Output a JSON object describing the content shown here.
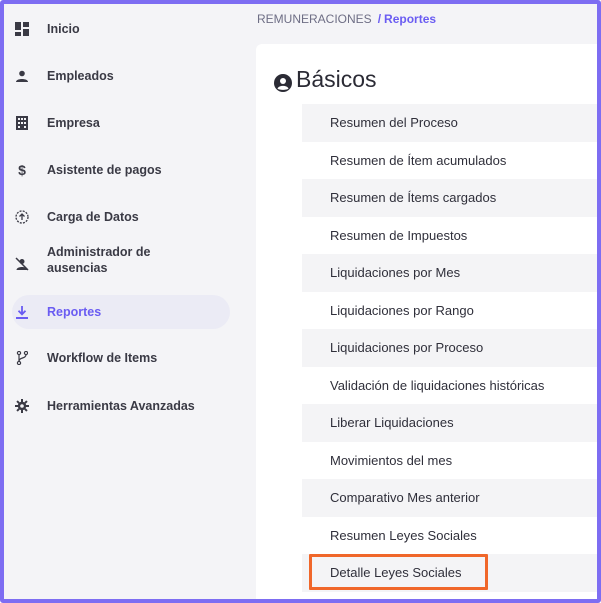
{
  "sidebar": {
    "items": [
      {
        "label": "Inicio",
        "icon": "dashboard-icon"
      },
      {
        "label": "Empleados",
        "icon": "person-icon"
      },
      {
        "label": "Empresa",
        "icon": "building-icon"
      },
      {
        "label": "Asistente de pagos",
        "icon": "dollar-icon"
      },
      {
        "label": "Carga de Datos",
        "icon": "upload-circle-icon"
      },
      {
        "label": "Administrador de ausencias",
        "icon": "person-off-icon"
      },
      {
        "label": "Reportes",
        "icon": "download-icon",
        "active": true
      },
      {
        "label": "Workflow de Items",
        "icon": "branch-icon"
      },
      {
        "label": "Herramientas Avanzadas",
        "icon": "gear-icon"
      }
    ]
  },
  "breadcrumb": {
    "parent": "REMUNERACIONES",
    "separator": "/",
    "current": "Reportes"
  },
  "panel": {
    "title": "Básicos",
    "title_icon": "user-circle-icon",
    "rows": [
      "Resumen del Proceso",
      "Resumen de Ítem acumulados",
      "Resumen de Ítems cargados",
      "Resumen de Impuestos",
      "Liquidaciones por Mes",
      "Liquidaciones por Rango",
      "Liquidaciones por Proceso",
      "Validación de liquidaciones históricas",
      "Liberar Liquidaciones",
      "Movimientos del mes",
      "Comparativo Mes anterior",
      "Resumen Leyes Sociales",
      "Detalle Leyes Sociales"
    ],
    "highlighted_row": "Detalle Leyes Sociales"
  },
  "colors": {
    "accent": "#6a5cf2",
    "frame": "#7d6df2",
    "highlight": "#f0672a"
  }
}
